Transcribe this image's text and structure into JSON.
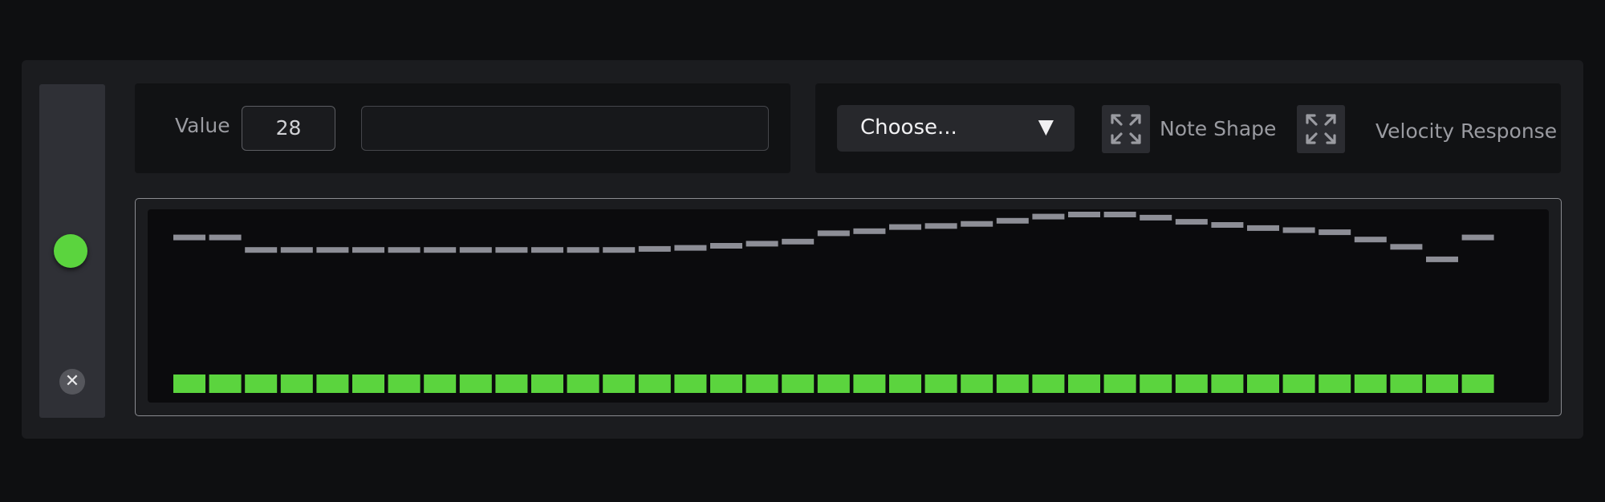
{
  "controls": {
    "value_label": "Value",
    "value": "28",
    "value_field": "",
    "dropdown_label": "Choose...",
    "dropdown_arrow": "▼",
    "note_shape_label": "Note Shape",
    "velocity_response_label": "Velocity Response",
    "close_symbol": "✕"
  },
  "status": {
    "led_color": "#5bd43e",
    "led_on": true
  },
  "icons": {
    "note_shape_icon": "expand-arrows-icon",
    "velocity_response_icon": "expand-arrows-icon",
    "close_icon": "close-icon"
  },
  "sequencer": {
    "step_count": 37,
    "step_color": "#5bd43e",
    "value_bar_color": "#8d8e96",
    "value_range": [
      0,
      100
    ],
    "step_active": [
      true,
      true,
      true,
      true,
      true,
      true,
      true,
      true,
      true,
      true,
      true,
      true,
      true,
      true,
      true,
      true,
      true,
      true,
      true,
      true,
      true,
      true,
      true,
      true,
      true,
      true,
      true,
      true,
      true,
      true,
      true,
      true,
      true,
      true,
      true,
      true,
      true
    ],
    "step_values": [
      68,
      68,
      56,
      56,
      56,
      56,
      56,
      56,
      56,
      56,
      56,
      56,
      56,
      57,
      58,
      60,
      62,
      64,
      72,
      74,
      78,
      79,
      81,
      84,
      88,
      90,
      90,
      87,
      83,
      80,
      77,
      75,
      73,
      66,
      59,
      47,
      68,
      68
    ]
  }
}
